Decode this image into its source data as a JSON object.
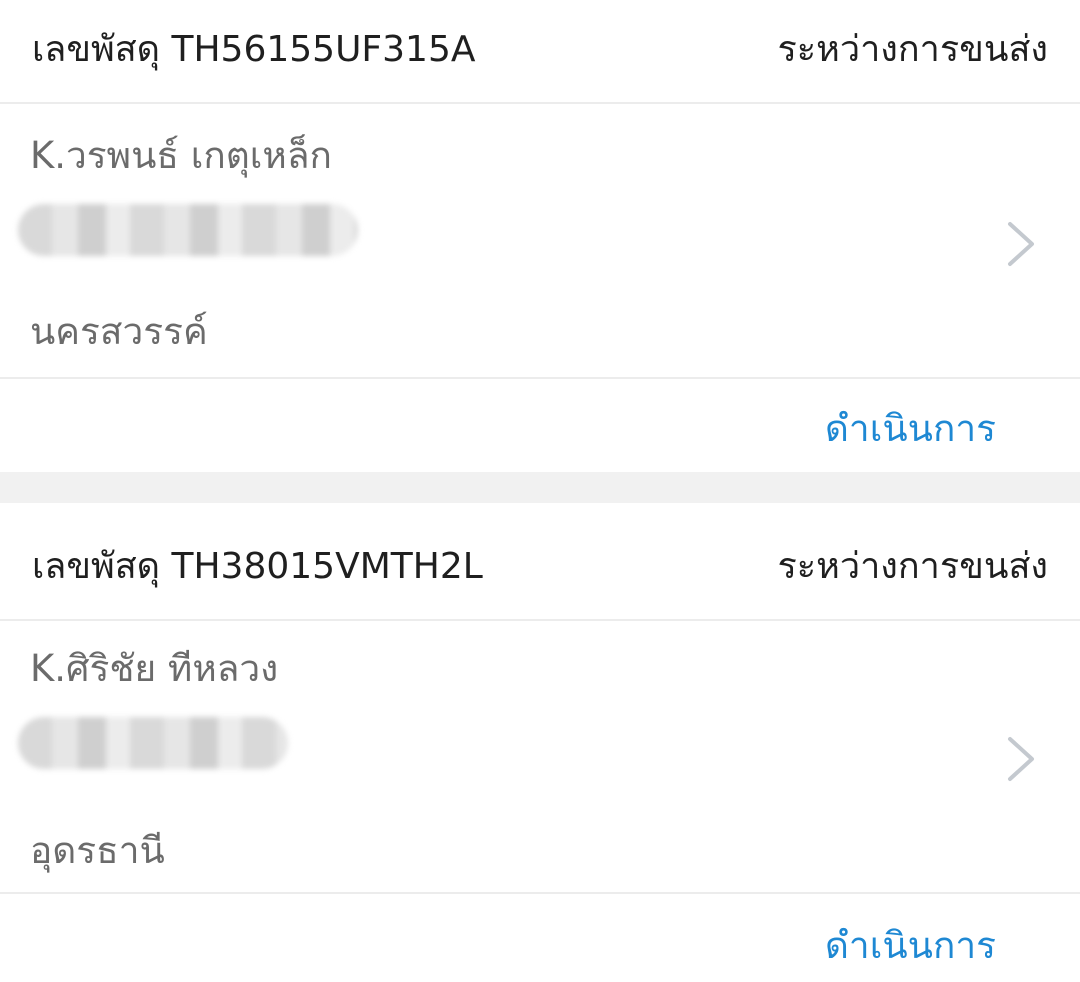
{
  "parcels": [
    {
      "tracking_label": "เลขพัสดุ TH56155UF315A",
      "status": "ระหว่างการขนส่ง",
      "recipient": "K.วรพนธ์ เกตุเหล็ก",
      "province": "นครสวรรค์",
      "action_label": "ดำเนินการ"
    },
    {
      "tracking_label": "เลขพัสดุ TH38015VMTH2L",
      "status": "ระหว่างการขนส่ง",
      "recipient": "K.ศิริชัย ทีหลวง",
      "province": "อุดรธานี",
      "action_label": "ดำเนินการ"
    }
  ],
  "icons": {
    "chevron": "chevron-right-icon"
  },
  "colors": {
    "action": "#1e88d3",
    "separator": "#f1f1f1",
    "secondary_text": "#6b6b6b"
  }
}
